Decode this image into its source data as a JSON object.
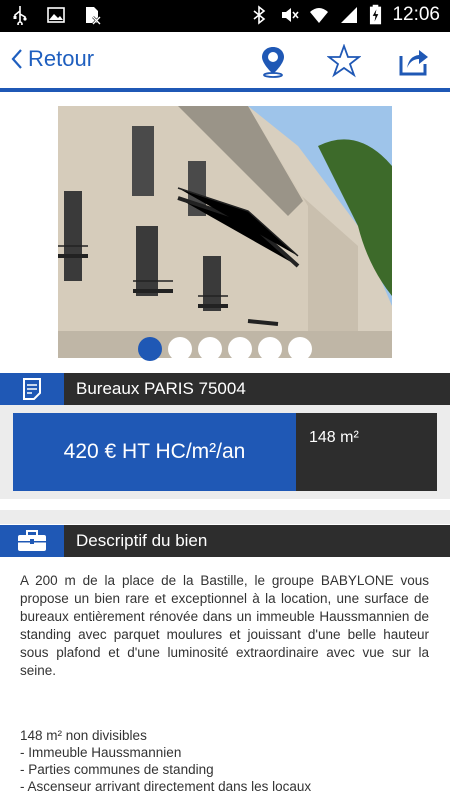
{
  "status_bar": {
    "time": "12:06",
    "icons": [
      "usb-icon",
      "image-icon",
      "sim-off-icon",
      "bluetooth-icon",
      "mute-icon",
      "wifi-icon",
      "signal-icon",
      "battery-icon"
    ]
  },
  "topbar": {
    "back_label": "Retour",
    "icons": [
      "location-pin-icon",
      "star-icon",
      "share-icon"
    ]
  },
  "gallery": {
    "image": "building-facade-photo",
    "page_count": 6,
    "active_index": 0
  },
  "property": {
    "title": "Bureaux PARIS 75004",
    "price": "420 € HT HC/m²/an",
    "area": "148 m²"
  },
  "description_section": {
    "title": "Descriptif du bien",
    "paragraph": "A 200 m de la place de la Bastille, le groupe BABYLONE vous propose un bien rare et exceptionnel à la location, une surface de bureaux entièrement rénovée dans un immeuble Haussmannien de standing avec parquet moulures et jouissant d'une belle hauteur sous plafond et d'une luminosité extraordinaire avec vue sur la seine.",
    "features": [
      "148 m² non divisibles",
      "- Immeuble Haussmannien",
      "- Parties communes de standing",
      "- Ascenseur arrivant directement dans les locaux"
    ]
  },
  "colors": {
    "accent": "#1f58b5",
    "dark": "#2d2d2d",
    "band": "#ececec"
  }
}
